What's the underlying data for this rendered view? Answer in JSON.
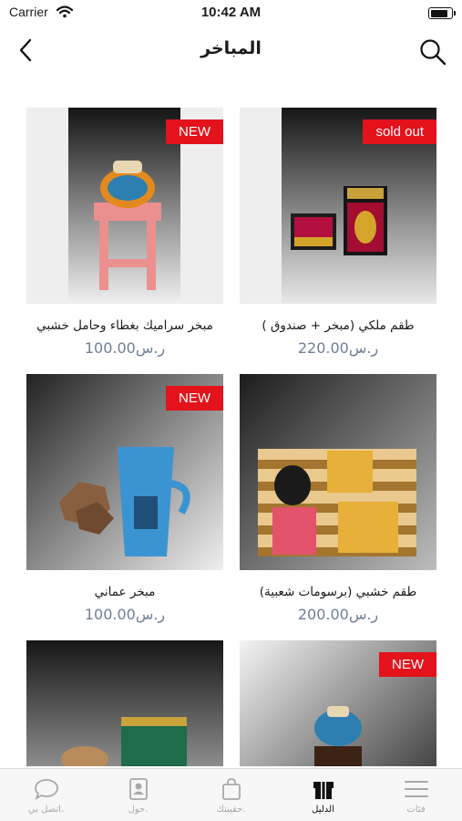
{
  "status_bar": {
    "carrier": "Carrier",
    "time": "10:42 AM",
    "battery_level": 0.9
  },
  "nav": {
    "title": "المباخر",
    "back_icon": "chevron-left-icon",
    "search_icon": "search-icon"
  },
  "colors": {
    "badge_red": "#e3121b",
    "price": "#6f7f95",
    "tab_inactive": "#a8a8a8"
  },
  "products": [
    {
      "name": "طقم ملكي (مبخر + صندوق )",
      "price": "ر.س220.00",
      "badge": "sold out"
    },
    {
      "name": "مبخر سراميك بغطاء وحامل خشبي",
      "price": "ر.س100.00",
      "badge": "NEW"
    },
    {
      "name": "طقم خشبي (برسومات شعبية)",
      "price": "ر.س200.00",
      "badge": ""
    },
    {
      "name": "مبخر عماني",
      "price": "ر.س100.00",
      "badge": "NEW"
    },
    {
      "name": "",
      "price": "",
      "badge": "NEW"
    },
    {
      "name": "",
      "price": "",
      "badge": ""
    }
  ],
  "tabs": [
    {
      "label": "اتصل بي.",
      "icon": "chat-bubble-icon"
    },
    {
      "label": "حول.",
      "icon": "contact-card-icon"
    },
    {
      "label": "حقيبتك.",
      "icon": "shopping-bag-icon"
    },
    {
      "label": "الدليل",
      "icon": "catalog-box-icon",
      "active": true
    },
    {
      "label": "فئات",
      "icon": "menu-icon"
    }
  ]
}
